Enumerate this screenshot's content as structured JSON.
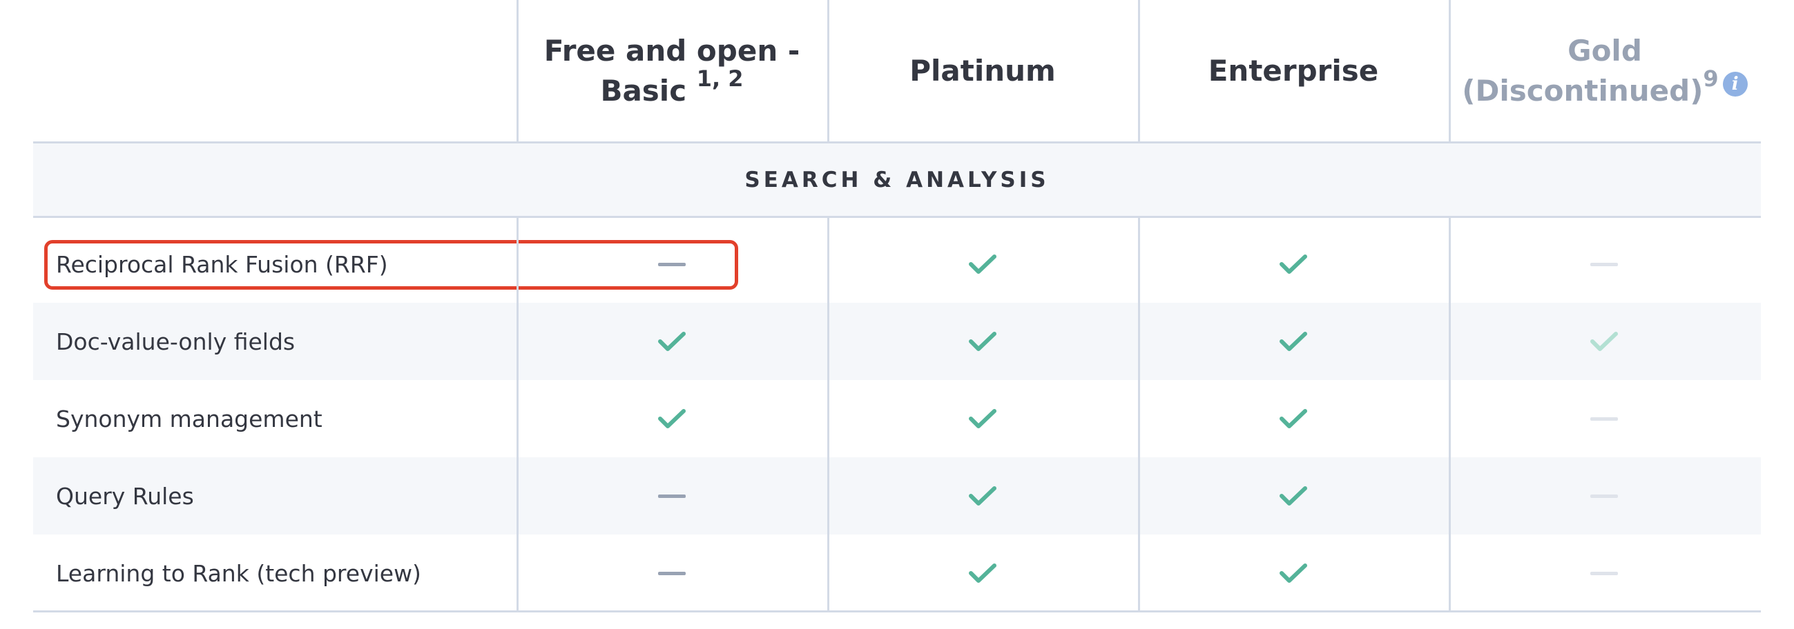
{
  "header": {
    "columns": [
      {
        "line1": "Free and open -",
        "line2": "Basic",
        "sup": "1, 2"
      },
      {
        "label": "Platinum"
      },
      {
        "label": "Enterprise"
      },
      {
        "line1": "Gold",
        "line2": "(Discontinued)",
        "sup": "9",
        "info_icon": "info-icon"
      }
    ]
  },
  "section": {
    "title": "SEARCH & ANALYSIS"
  },
  "rows": [
    {
      "label": "Reciprocal Rank Fusion (RRF)",
      "cells": [
        "dash",
        "check",
        "check",
        "dash-faded"
      ],
      "highlighted": true
    },
    {
      "label": "Doc-value-only fields",
      "cells": [
        "check",
        "check",
        "check",
        "check-faded"
      ]
    },
    {
      "label": "Synonym management",
      "cells": [
        "check",
        "check",
        "check",
        "dash-faded"
      ]
    },
    {
      "label": "Query Rules",
      "cells": [
        "dash",
        "check",
        "check",
        "dash-faded"
      ]
    },
    {
      "label": "Learning to Rank (tech preview)",
      "cells": [
        "dash",
        "check",
        "check",
        "dash-faded"
      ]
    }
  ],
  "colors": {
    "check": "#54b399",
    "check_faded": "#b3e0d3",
    "dash": "#98a2b3",
    "dash_faded": "#dfe3ea",
    "highlight": "#e2402b",
    "band": "#f5f7fa",
    "gold_header": "#98a2b3",
    "info_icon": "#8fb1e3"
  }
}
